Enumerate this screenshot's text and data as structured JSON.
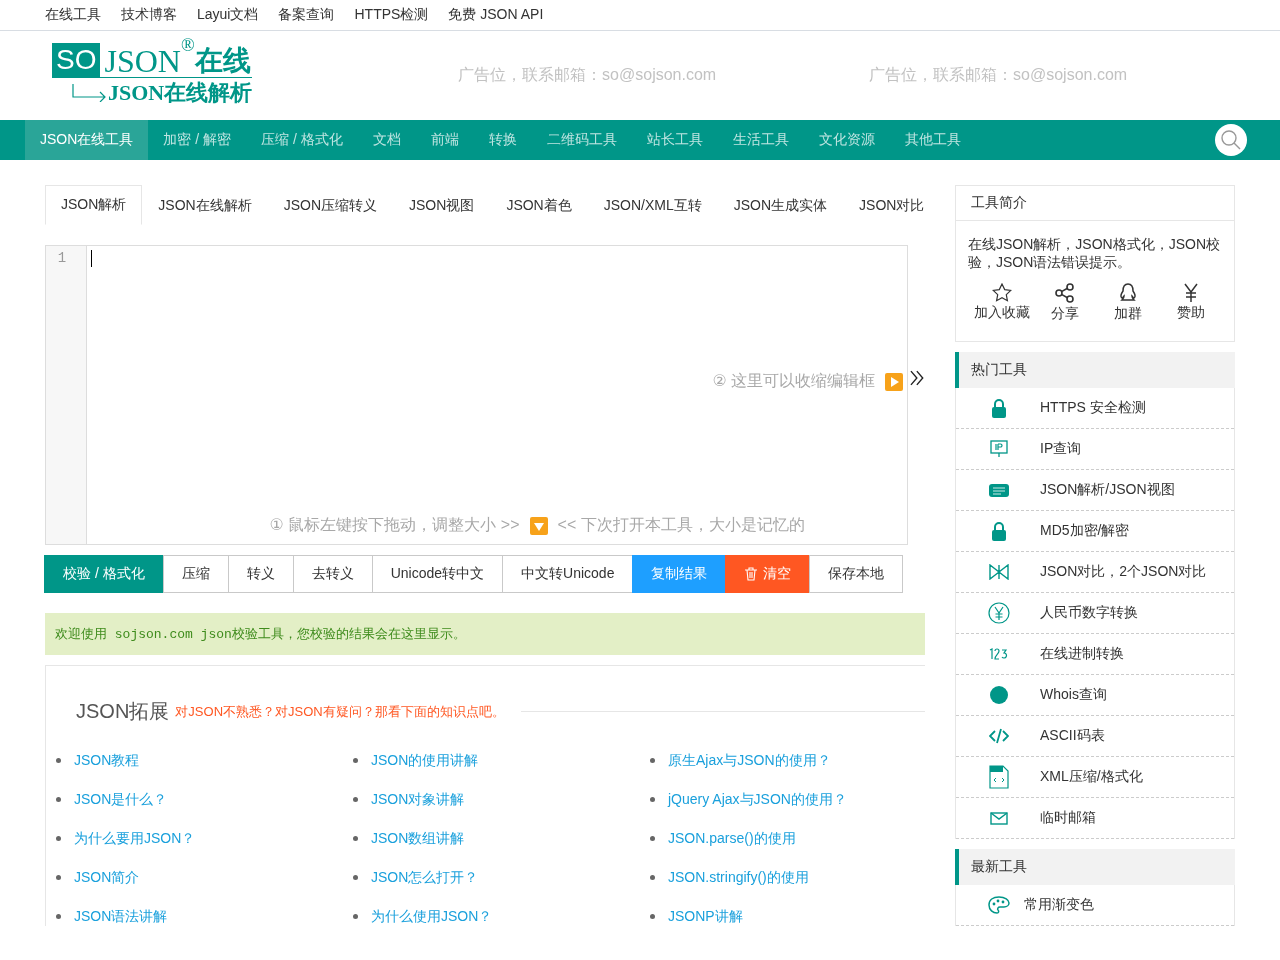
{
  "top_links": [
    "在线工具",
    "技术博客",
    "Layui文档",
    "备案查询",
    "HTTPS检测",
    "免费 JSON API"
  ],
  "logo": {
    "badge": "SO",
    "name": "JSON",
    "mark": "®",
    "suffix": "在线",
    "subtitle": "JSON在线解析"
  },
  "ads": [
    "广告位，联系邮箱：so@sojson.com",
    "广告位，联系邮箱：so@sojson.com"
  ],
  "nav": [
    {
      "label": "JSON在线工具",
      "selected": true
    },
    {
      "label": "加密 / 解密",
      "selected": false
    },
    {
      "label": "压缩 / 格式化",
      "selected": false
    },
    {
      "label": "文档",
      "selected": false
    },
    {
      "label": "前端",
      "selected": false
    },
    {
      "label": "转换",
      "selected": false
    },
    {
      "label": "二维码工具",
      "selected": false
    },
    {
      "label": "站长工具",
      "selected": false
    },
    {
      "label": "生活工具",
      "selected": false
    },
    {
      "label": "文化资源",
      "selected": false
    },
    {
      "label": "其他工具",
      "selected": false
    }
  ],
  "tabs": [
    {
      "label": "JSON解析",
      "selected": true
    },
    {
      "label": "JSON在线解析",
      "selected": false
    },
    {
      "label": "JSON压缩转义",
      "selected": false
    },
    {
      "label": "JSON视图",
      "selected": false
    },
    {
      "label": "JSON着色",
      "selected": false
    },
    {
      "label": "JSON/XML互转",
      "selected": false
    },
    {
      "label": "JSON生成实体",
      "selected": false
    },
    {
      "label": "JSON对比",
      "selected": false
    }
  ],
  "editor": {
    "line_numbers": [
      "1"
    ],
    "collapse_hint": "②  这里可以收缩编辑框",
    "resize_hint_left": "①  鼠标左键按下拖动，调整大小  >>",
    "resize_hint_right": "<<  下次打开本工具，大小是记忆的"
  },
  "actions": [
    {
      "label": "校验 / 格式化",
      "kind": "primary"
    },
    {
      "label": "压缩",
      "kind": "default"
    },
    {
      "label": "转义",
      "kind": "default"
    },
    {
      "label": "去转义",
      "kind": "default"
    },
    {
      "label": "Unicode转中文",
      "kind": "default"
    },
    {
      "label": "中文转Unicode",
      "kind": "default"
    },
    {
      "label": "复制结果",
      "kind": "blue"
    },
    {
      "label": "清空",
      "kind": "danger"
    },
    {
      "label": "保存本地",
      "kind": "default"
    }
  ],
  "result": {
    "text": "欢迎使用 sojson.com json校验工具，您校验的结果会在这里显示。"
  },
  "extension": {
    "title": "JSON拓展",
    "subtitle": "对JSON不熟悉？对JSON有疑问？那看下面的知识点吧。",
    "links": [
      "JSON教程",
      "JSON的使用讲解",
      "原生Ajax与JSON的使用？",
      "JSON是什么？",
      "JSON对象讲解",
      "jQuery Ajax与JSON的使用？",
      "为什么要用JSON？",
      "JSON数组讲解",
      "JSON.parse()的使用",
      "JSON简介",
      "JSON怎么打开？",
      "JSON.stringify()的使用",
      "JSON语法讲解",
      "为什么使用JSON？",
      "JSONP讲解"
    ]
  },
  "intro": {
    "title": "工具简介",
    "text": "在线JSON解析，JSON格式化，JSON校验，JSON语法错误提示。",
    "actions": [
      "加入收藏",
      "分享",
      "加群",
      "赞助"
    ]
  },
  "hot_tools": {
    "title": "热门工具",
    "items": [
      "HTTPS 安全检测",
      "IP查询",
      "JSON解析/JSON视图",
      "MD5加密/解密",
      "JSON对比，2个JSON对比",
      "人民币数字转换",
      "在线进制转换",
      "Whois查询",
      "ASCII码表",
      "XML压缩/格式化",
      "临时邮箱"
    ]
  },
  "new_tools": {
    "title": "最新工具",
    "items": [
      "常用渐变色"
    ]
  }
}
